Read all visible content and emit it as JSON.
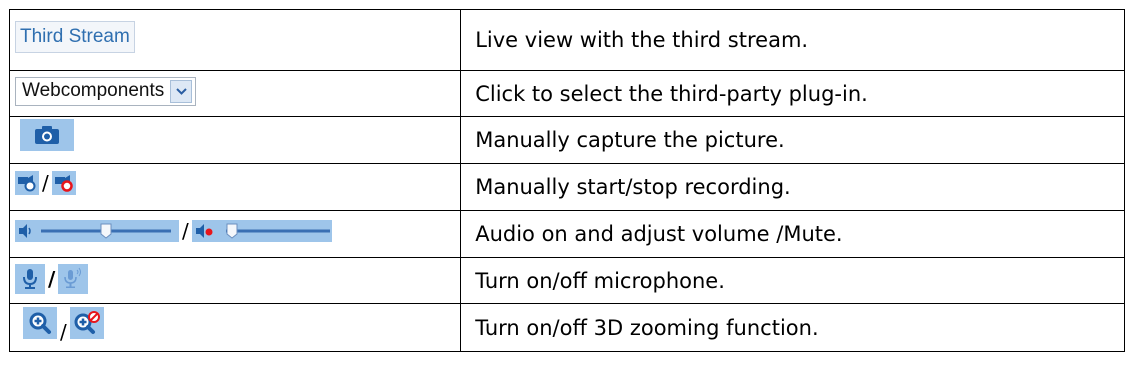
{
  "rows": [
    {
      "control": {
        "label": "Third Stream"
      },
      "description": "Live view with the third stream."
    },
    {
      "control": {
        "label": "Webcomponents",
        "icon": "chevron-down-icon"
      },
      "description": "Click to select the third-party plug-in."
    },
    {
      "control": {
        "icon": "camera-icon"
      },
      "description": "Manually capture the picture."
    },
    {
      "control": {
        "icons": [
          "record-start-icon",
          "record-stop-icon"
        ],
        "separator": "/"
      },
      "description": "Manually start/stop recording."
    },
    {
      "control": {
        "icons": [
          "volume-slider",
          "mute-slider"
        ],
        "separator": "/"
      },
      "description": "Audio on and adjust volume /Mute."
    },
    {
      "control": {
        "icons": [
          "microphone-on-icon",
          "microphone-off-icon"
        ],
        "separator": "/"
      },
      "description": "Turn on/off microphone."
    },
    {
      "control": {
        "icons": [
          "zoom-3d-on-icon",
          "zoom-3d-off-icon"
        ],
        "separator": "/"
      },
      "description": "Turn on/off 3D zooming function."
    }
  ],
  "colors": {
    "icon_bg": "#9ec5ea",
    "icon_fg": "#1f5fa8",
    "stop_red": "#e8151b",
    "stream_text": "#2f6fb0"
  }
}
